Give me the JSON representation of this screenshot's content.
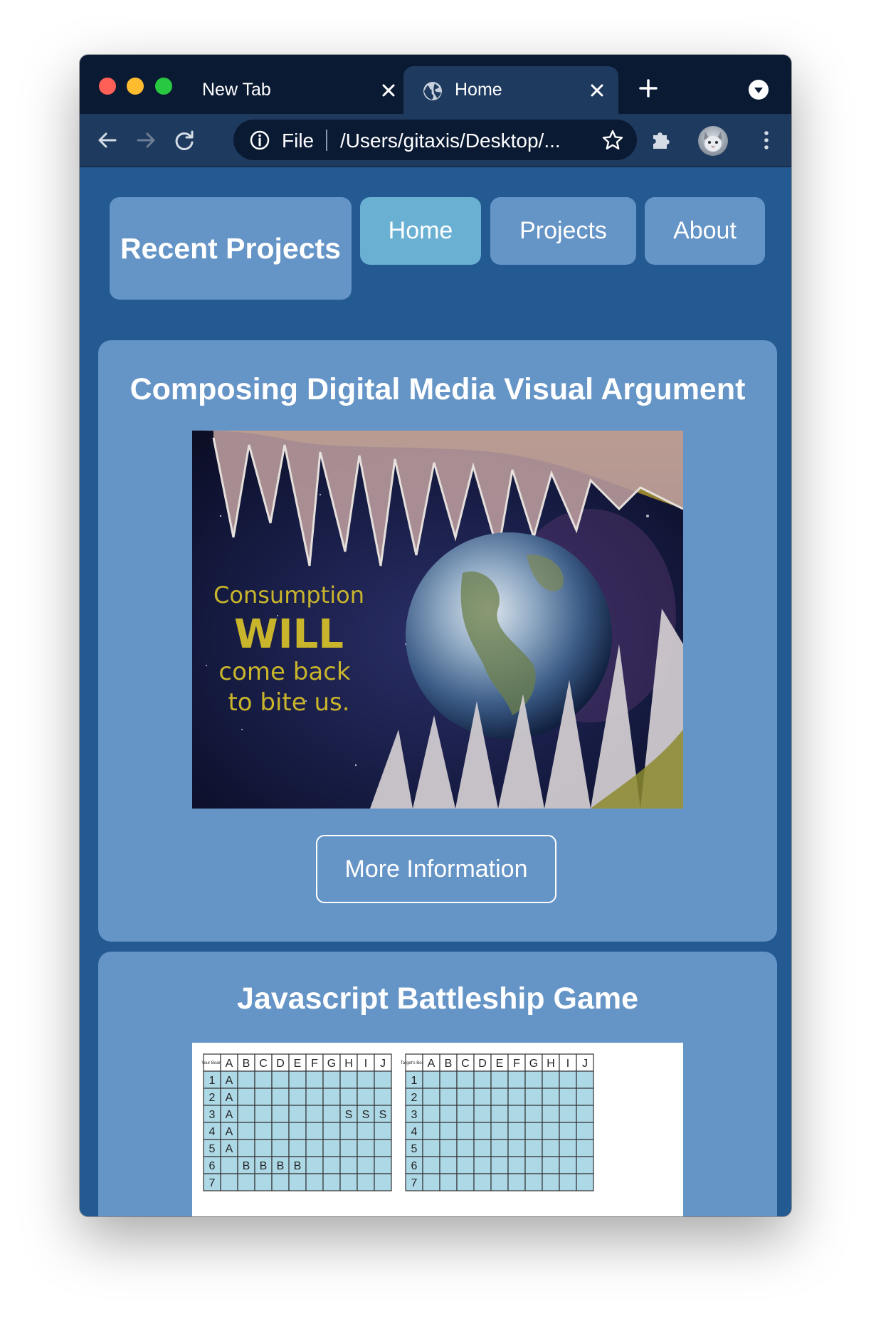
{
  "browser": {
    "tabs": [
      {
        "label": "New Tab"
      },
      {
        "label": "Home",
        "active": true
      }
    ],
    "address": {
      "scheme_label": "File",
      "url": "/Users/gitaxis/Desktop/..."
    }
  },
  "nav": {
    "recent": "Recent Projects",
    "home": "Home",
    "projects": "Projects",
    "about": "About"
  },
  "cards": [
    {
      "title": "Composing Digital Media Visual Argument",
      "image_text": [
        "Consumption",
        "WILL",
        "come back",
        "to bite us."
      ],
      "button": "More Information"
    },
    {
      "title": "Javascript Battleship Game",
      "board": {
        "your_label": "Your Board",
        "target_label": "Target's Board",
        "columns": [
          "A",
          "B",
          "C",
          "D",
          "E",
          "F",
          "G",
          "H",
          "I",
          "J"
        ],
        "rows": [
          "1",
          "2",
          "3",
          "4",
          "5",
          "6",
          "7"
        ]
      }
    }
  ],
  "colors": {
    "page_bg": "#235a91",
    "card_bg": "#6594c6",
    "nav_active": "#6ab0d3",
    "grid_cell": "#add8e6"
  }
}
